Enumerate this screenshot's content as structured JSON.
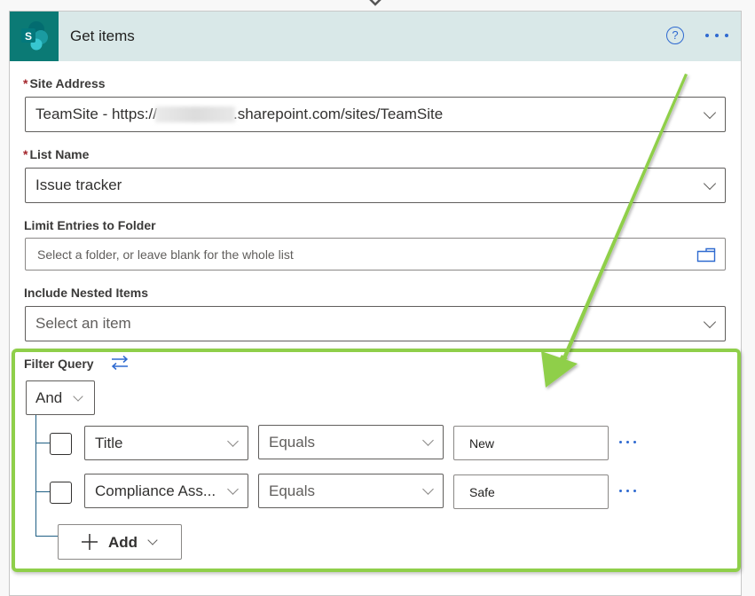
{
  "card": {
    "title": "Get items",
    "icons": {
      "logo": "sharepoint-logo",
      "help": "help-icon",
      "more": "more-options-icon"
    }
  },
  "fields": {
    "site_address": {
      "label": "Site Address",
      "required_marker": "*",
      "value_prefix": "TeamSite - https://",
      "value_suffix": ".sharepoint.com/sites/TeamSite"
    },
    "list_name": {
      "label": "List Name",
      "required_marker": "*",
      "value": "Issue tracker"
    },
    "limit_folder": {
      "label": "Limit Entries to Folder",
      "placeholder": "Select a folder, or leave blank for the whole list"
    },
    "nested_items": {
      "label": "Include Nested Items",
      "placeholder": "Select an item"
    }
  },
  "filter": {
    "label": "Filter Query",
    "group_operator": "And",
    "rows": [
      {
        "field": "Title",
        "operator": "Equals",
        "value": "New"
      },
      {
        "field": "Compliance Ass...",
        "operator": "Equals",
        "value": "Safe"
      }
    ],
    "add_label": "Add"
  },
  "colors": {
    "header_bg": "#d9e8e8",
    "logo_bg": "#0b7a75",
    "accent_blue": "#2f6ad0",
    "highlight_green": "#8fcf4a",
    "required_red": "#a4262c"
  }
}
